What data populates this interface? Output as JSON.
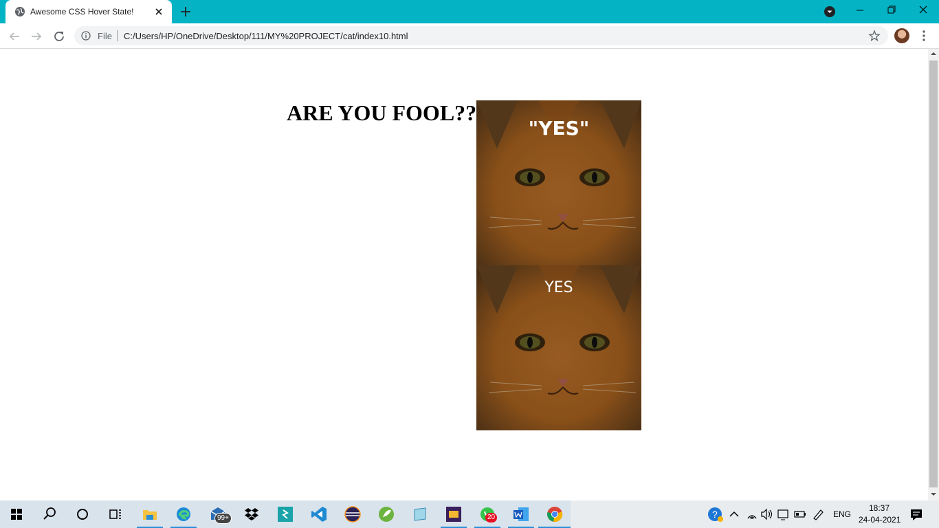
{
  "browser": {
    "tab_title": "Awesome CSS Hover State!",
    "address_prefix": "File",
    "url": "C:/Users/HP/OneDrive/Desktop/111/MY%20PROJECT/cat/index10.html",
    "accent_color": "#04b3c4"
  },
  "page": {
    "heading": "ARE YOU FOOL??",
    "cards": [
      {
        "caption": "\"YES\"",
        "style": "bold",
        "image": "orange-cat-photo"
      },
      {
        "caption": "YES",
        "style": "light",
        "image": "orange-cat-photo"
      }
    ]
  },
  "taskbar": {
    "apps": [
      "windows-start",
      "search",
      "cortana",
      "task-view",
      "file-explorer",
      "edge",
      "mail",
      "dropbox",
      "sublime-text",
      "vscode",
      "eclipse",
      "spring-tools",
      "notepad",
      "aegis-game",
      "whatsapp",
      "word",
      "chrome"
    ],
    "mail_badge": "99+",
    "whatsapp_badge": "20",
    "language": "ENG",
    "time": "18:37",
    "date": "24-04-2021"
  }
}
